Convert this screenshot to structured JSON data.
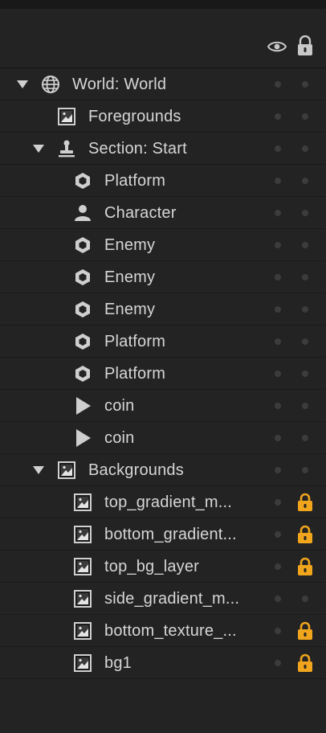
{
  "header": {
    "visibility_icon": "eye-icon",
    "lock_icon": "lock-icon"
  },
  "colors": {
    "background": "#232323",
    "lock_accent": "#f0a51c",
    "dot": "#3c3c3c"
  },
  "tree": [
    {
      "label": "World: World",
      "icon": "globe-icon",
      "depth": 0,
      "arrow": true,
      "locked": false
    },
    {
      "label": "Foregrounds",
      "icon": "image-icon",
      "depth": 1,
      "arrow": false,
      "locked": false
    },
    {
      "label": "Section: Start",
      "icon": "stamp-icon",
      "depth": 1,
      "arrow": true,
      "locked": false
    },
    {
      "label": "Platform",
      "icon": "hexagon-icon",
      "depth": 2,
      "arrow": false,
      "locked": false
    },
    {
      "label": "Character",
      "icon": "person-icon",
      "depth": 2,
      "arrow": false,
      "locked": false
    },
    {
      "label": "Enemy",
      "icon": "hexagon-icon",
      "depth": 2,
      "arrow": false,
      "locked": false
    },
    {
      "label": "Enemy",
      "icon": "hexagon-icon",
      "depth": 2,
      "arrow": false,
      "locked": false
    },
    {
      "label": "Enemy",
      "icon": "hexagon-icon",
      "depth": 2,
      "arrow": false,
      "locked": false
    },
    {
      "label": "Platform",
      "icon": "hexagon-icon",
      "depth": 2,
      "arrow": false,
      "locked": false
    },
    {
      "label": "Platform",
      "icon": "hexagon-icon",
      "depth": 2,
      "arrow": false,
      "locked": false
    },
    {
      "label": "coin",
      "icon": "play-icon",
      "depth": 2,
      "arrow": false,
      "locked": false
    },
    {
      "label": "coin",
      "icon": "play-icon",
      "depth": 2,
      "arrow": false,
      "locked": false
    },
    {
      "label": "Backgrounds",
      "icon": "image-icon",
      "depth": 1,
      "arrow": true,
      "locked": false
    },
    {
      "label": "top_gradient_m...",
      "icon": "image-icon",
      "depth": 2,
      "arrow": false,
      "locked": true
    },
    {
      "label": "bottom_gradient...",
      "icon": "image-icon",
      "depth": 2,
      "arrow": false,
      "locked": true
    },
    {
      "label": "top_bg_layer",
      "icon": "image-icon",
      "depth": 2,
      "arrow": false,
      "locked": true
    },
    {
      "label": "side_gradient_m...",
      "icon": "image-icon",
      "depth": 2,
      "arrow": false,
      "locked": false
    },
    {
      "label": "bottom_texture_...",
      "icon": "image-icon",
      "depth": 2,
      "arrow": false,
      "locked": true
    },
    {
      "label": "bg1",
      "icon": "image-icon",
      "depth": 2,
      "arrow": false,
      "locked": true
    }
  ]
}
